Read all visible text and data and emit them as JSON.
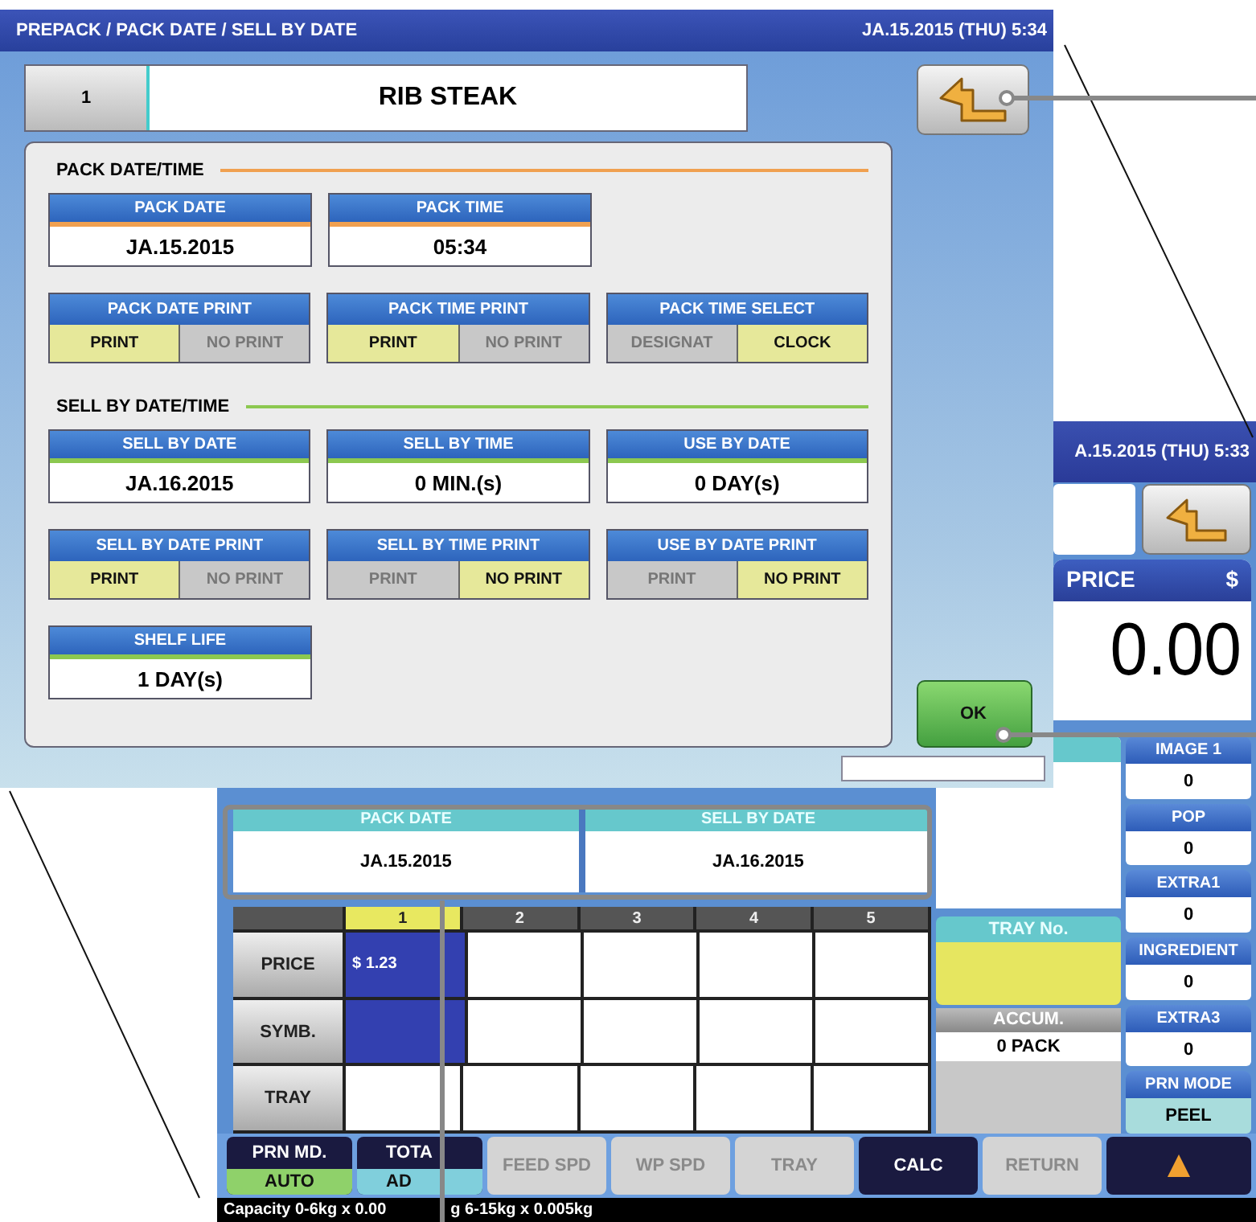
{
  "dialog": {
    "title": "PREPACK / PACK DATE / SELL BY DATE",
    "datetime": "JA.15.2015 (THU)  5:34",
    "item_number": "1",
    "item_name": "RIB STEAK",
    "ok_button": "OK",
    "sections": [
      {
        "title": "PACK DATE/TIME",
        "color": "#f0a050",
        "rows": [
          [
            {
              "kind": "value",
              "label": "PACK DATE",
              "value": "JA.15.2015"
            },
            {
              "kind": "value",
              "label": "PACK TIME",
              "value": "05:34"
            }
          ],
          [
            {
              "kind": "toggle",
              "label": "PACK DATE PRINT",
              "options": [
                {
                  "label": "PRINT",
                  "selected": true
                },
                {
                  "label": "NO PRINT",
                  "selected": false
                }
              ]
            },
            {
              "kind": "toggle",
              "label": "PACK TIME PRINT",
              "options": [
                {
                  "label": "PRINT",
                  "selected": true
                },
                {
                  "label": "NO PRINT",
                  "selected": false
                }
              ]
            },
            {
              "kind": "toggle",
              "label": "PACK TIME SELECT",
              "options": [
                {
                  "label": "DESIGNAT",
                  "selected": false
                },
                {
                  "label": "CLOCK",
                  "selected": true
                }
              ]
            }
          ]
        ]
      },
      {
        "title": "SELL BY DATE/TIME",
        "color": "#8cc850",
        "rows": [
          [
            {
              "kind": "value",
              "label": "SELL BY DATE",
              "value": "JA.16.2015"
            },
            {
              "kind": "value",
              "label": "SELL BY TIME",
              "value": "0 MIN.(s)"
            },
            {
              "kind": "value",
              "label": "USE BY DATE",
              "value": "0 DAY(s)"
            }
          ],
          [
            {
              "kind": "toggle",
              "label": "SELL BY DATE PRINT",
              "options": [
                {
                  "label": "PRINT",
                  "selected": true
                },
                {
                  "label": "NO PRINT",
                  "selected": false
                }
              ]
            },
            {
              "kind": "toggle",
              "label": "SELL BY TIME PRINT",
              "options": [
                {
                  "label": "PRINT",
                  "selected": false
                },
                {
                  "label": "NO PRINT",
                  "selected": true
                }
              ]
            },
            {
              "kind": "toggle",
              "label": "USE BY DATE PRINT",
              "options": [
                {
                  "label": "PRINT",
                  "selected": false
                },
                {
                  "label": "NO PRINT",
                  "selected": true
                }
              ]
            }
          ],
          [
            {
              "kind": "value",
              "label": "SHELF LIFE",
              "value": "1 DAY(s)"
            }
          ]
        ]
      }
    ]
  },
  "main_screen": {
    "datetime": "A.15.2015 (THU)  5:33",
    "price_label": "PRICE",
    "currency": "$",
    "price": "0.00",
    "date_panels": [
      {
        "label": "PACK DATE",
        "value": "JA.15.2015"
      },
      {
        "label": "SELL BY DATE",
        "value": "JA.16.2015"
      }
    ],
    "table": {
      "columns": [
        {
          "label": "1",
          "selected": true
        },
        {
          "label": "2",
          "selected": false
        },
        {
          "label": "3",
          "selected": false
        },
        {
          "label": "4",
          "selected": false
        },
        {
          "label": "5",
          "selected": false
        }
      ],
      "rows": [
        {
          "label": "PRICE",
          "selected": true,
          "value": "$ 1.23"
        },
        {
          "label": "SYMB.",
          "selected": true
        },
        {
          "label": "TRAY",
          "selected": false
        }
      ]
    },
    "tray_no": {
      "label": "TRAY No."
    },
    "accum": {
      "label": "ACCUM.",
      "value": "0 PACK"
    },
    "side_items": [
      {
        "kind": "counter",
        "label": "IMAGE 1",
        "value": "0"
      },
      {
        "kind": "counter",
        "label": "POP",
        "value": "0"
      },
      {
        "kind": "counter",
        "label": "EXTRA1",
        "value": "0"
      },
      {
        "kind": "counter",
        "label": "INGREDIENT",
        "value": "0"
      },
      {
        "kind": "counter",
        "label": "EXTRA3",
        "value": "0"
      },
      {
        "kind": "mode",
        "label": "PRN MODE",
        "value": "PEEL"
      }
    ],
    "buttons": [
      {
        "kind": "mode",
        "label": "PRN MD.",
        "value": "AUTO",
        "color": "#8fd16a"
      },
      {
        "kind": "mode",
        "label": "TOTA",
        "value": "AD",
        "color": "#80cfdc"
      },
      {
        "kind": "key",
        "label": "FEED SPD",
        "disabled": true
      },
      {
        "kind": "key",
        "label": "WP SPD",
        "disabled": true
      },
      {
        "kind": "key",
        "label": "TRAY",
        "disabled": true
      },
      {
        "kind": "key",
        "label": "CALC",
        "disabled": false
      },
      {
        "kind": "key",
        "label": "RETURN",
        "disabled": true
      },
      {
        "kind": "arrow",
        "label": "▲"
      }
    ],
    "status_bar": [
      "Capacity 0-6kg x 0.00",
      "g  6-15kg x 0.005kg"
    ]
  }
}
